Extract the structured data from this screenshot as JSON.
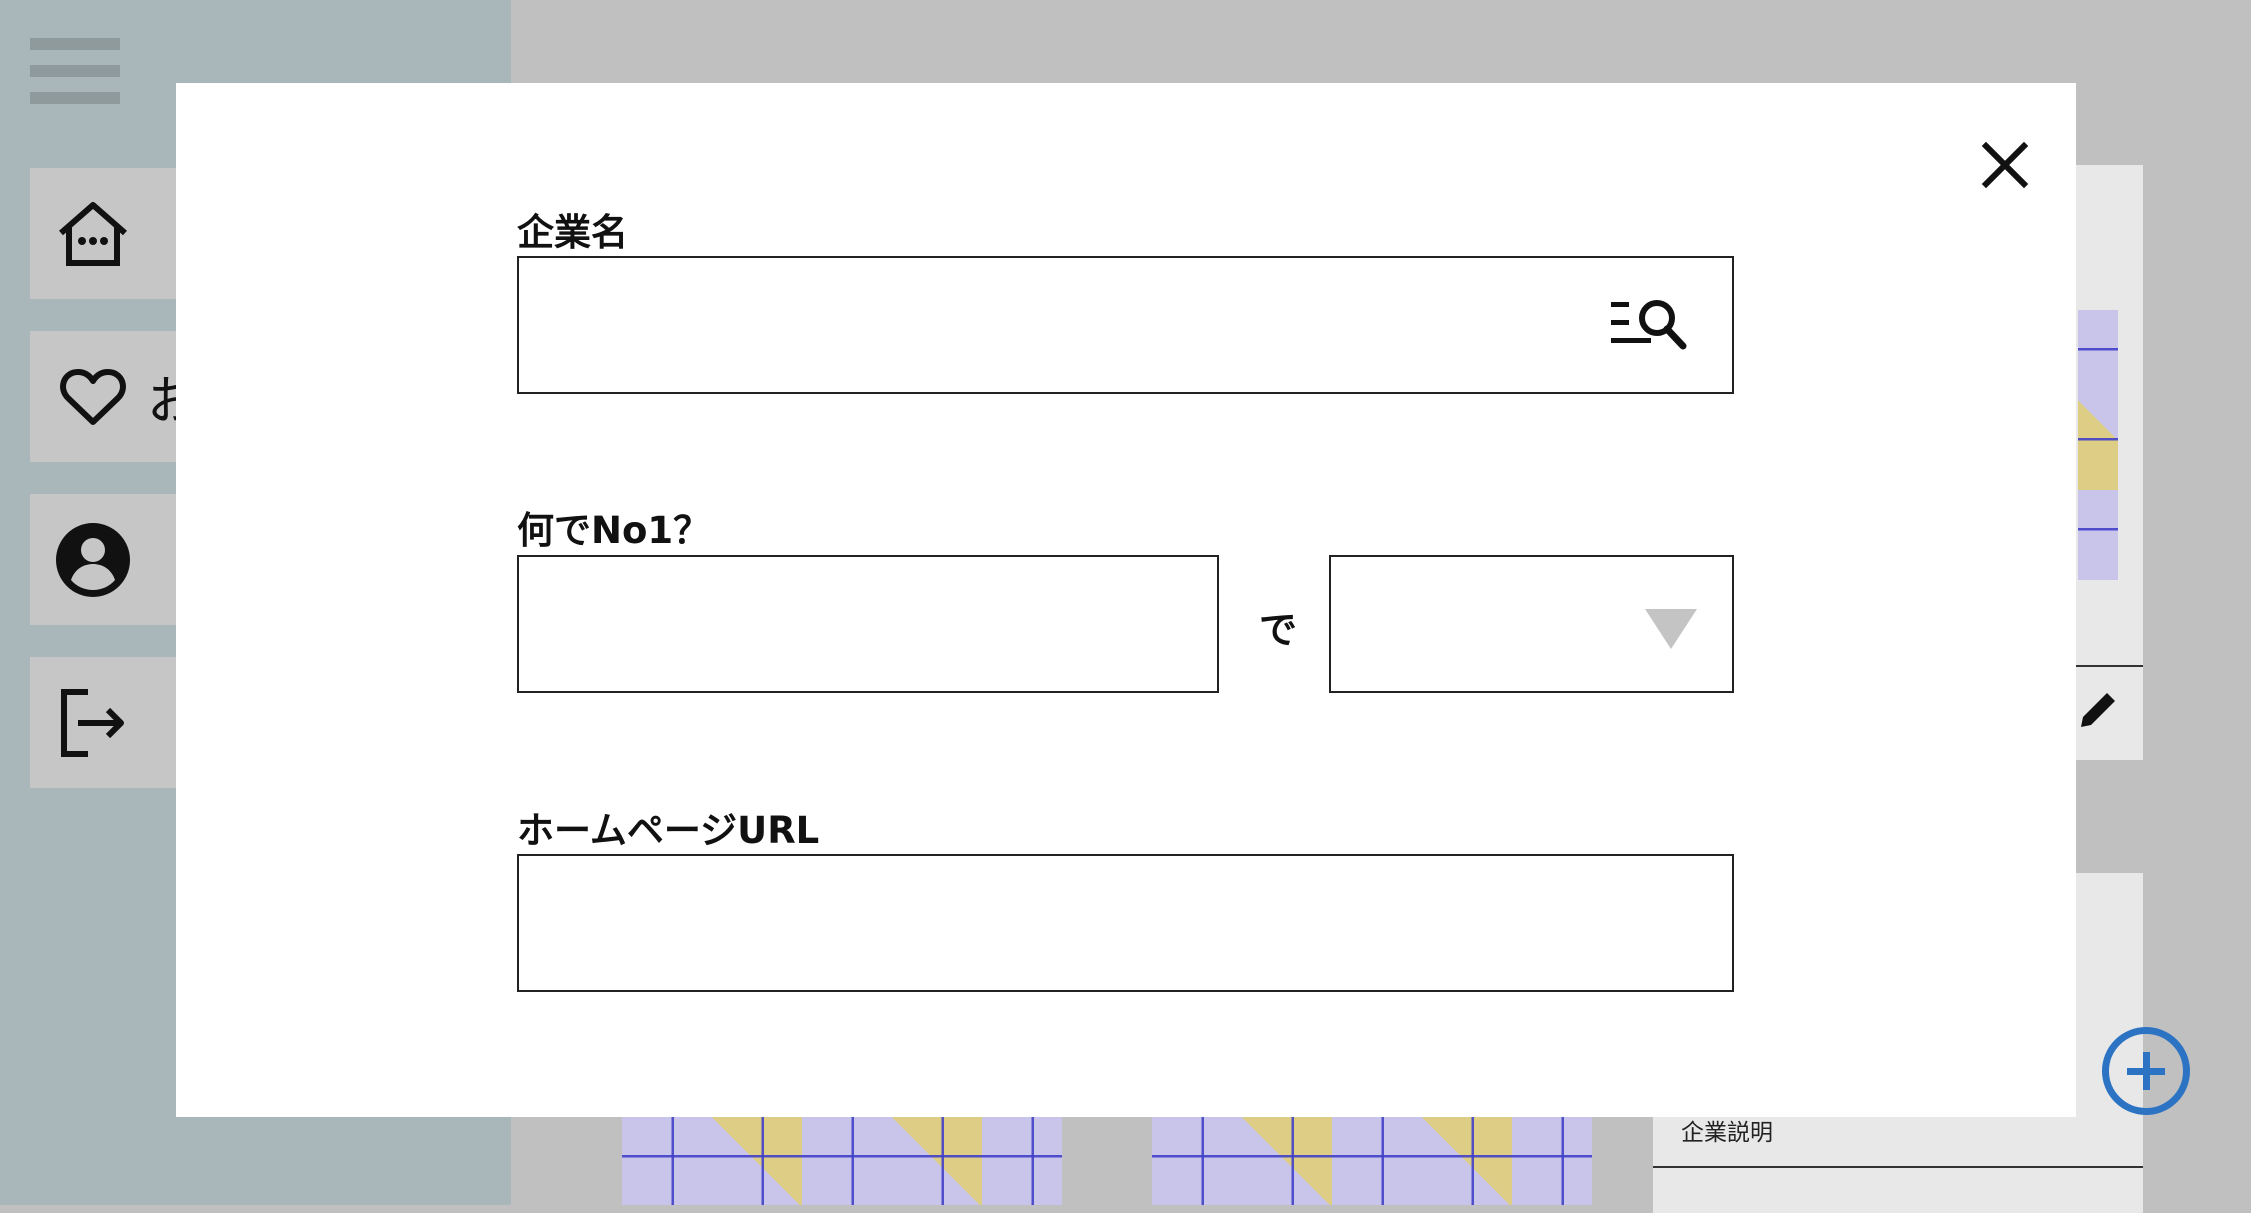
{
  "sidebar": {
    "items": [
      {
        "label": ""
      },
      {
        "label": "お"
      },
      {
        "label": ""
      },
      {
        "label": ""
      }
    ]
  },
  "background": {
    "card_description": "企業説明"
  },
  "modal": {
    "company_name": {
      "label": "企業名",
      "value": ""
    },
    "number_one": {
      "label": "何でNo1？",
      "value": "",
      "connector": "で",
      "select_value": ""
    },
    "homepage_url": {
      "label": "ホームページURL",
      "value": ""
    }
  },
  "colors": {
    "sidebar": "#a9b7ba",
    "overlay": "#c0c0c0",
    "accent": "#2c73c4"
  }
}
